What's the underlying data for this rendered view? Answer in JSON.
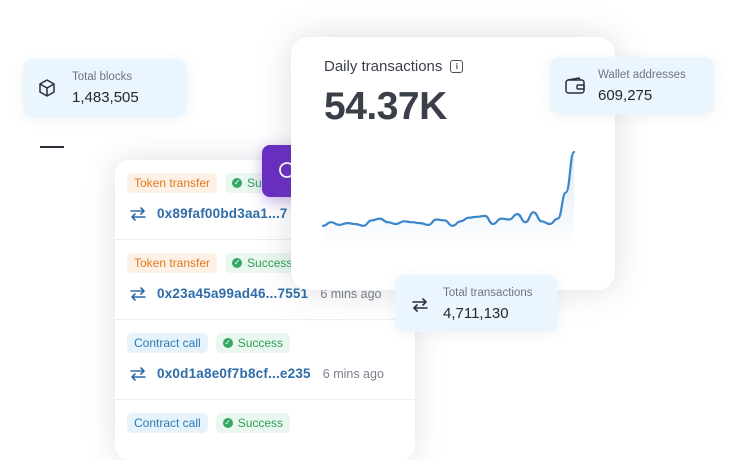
{
  "tx_list": {
    "rows": [
      {
        "type_label": "Token transfer",
        "type_kind": "transfer",
        "status": "Success",
        "hash": "0x89faf00bd3aa1...7",
        "age": ""
      },
      {
        "type_label": "Token transfer",
        "type_kind": "transfer",
        "status": "Success",
        "hash": "0x23a45a99ad46...7551",
        "age": "6 mins ago"
      },
      {
        "type_label": "Contract call",
        "type_kind": "contract",
        "status": "Success",
        "hash": "0x0d1a8e0f7b8cf...e235",
        "age": "6 mins ago"
      },
      {
        "type_label": "Contract call",
        "type_kind": "contract",
        "status": "Success",
        "hash": "",
        "age": ""
      }
    ]
  },
  "search": {
    "icon": "search-icon"
  },
  "daily": {
    "title": "Daily transactions",
    "value": "54.37K",
    "icon": "info-icon"
  },
  "stats": {
    "blocks": {
      "label": "Total blocks",
      "value": "1,483,505",
      "icon": "cube-icon"
    },
    "wallet": {
      "label": "Wallet addresses",
      "value": "609,275",
      "icon": "wallet-icon"
    },
    "total_tx": {
      "label": "Total transactions",
      "value": "4,711,130",
      "icon": "swap-arrows-icon"
    }
  },
  "colors": {
    "accent_purple": "#6a2ec2",
    "line_blue": "#3a86c9",
    "hash_blue": "#2e6ca8",
    "card_bg": "#eaf5fd",
    "transfer_orange": "#e07b1f",
    "contract_blue": "#2a7ab8",
    "success_green": "#2e9e5b"
  },
  "chart_data": {
    "type": "line",
    "title": "Daily transactions",
    "xlabel": "",
    "ylabel": "",
    "grid": false,
    "series": [
      {
        "values": [
          18,
          22,
          19,
          21,
          20,
          18,
          24,
          26,
          22,
          20,
          23,
          22,
          21,
          19,
          25,
          24,
          18,
          23,
          27,
          28,
          29,
          20,
          26,
          25,
          31,
          22,
          33,
          23,
          20,
          26,
          55,
          100
        ]
      }
    ],
    "ylim": [
      0,
      100
    ]
  }
}
